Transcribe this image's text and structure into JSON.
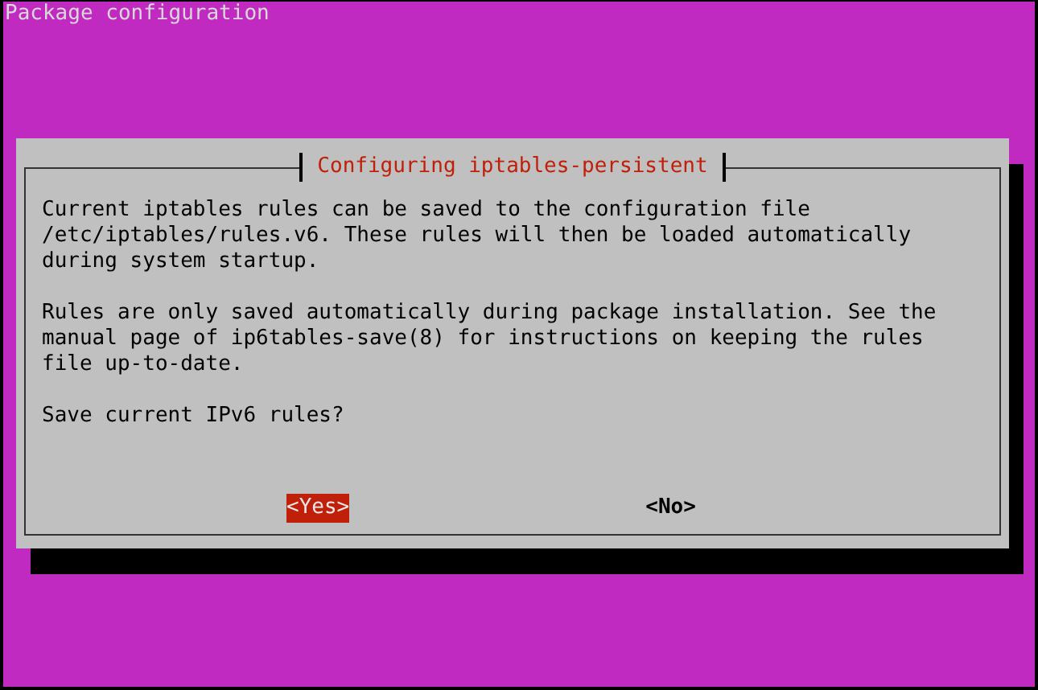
{
  "window": {
    "title": "Package configuration"
  },
  "dialog": {
    "title": "Configuring iptables-persistent",
    "paragraphs": [
      "Current iptables rules can be saved to the configuration file\n/etc/iptables/rules.v6. These rules will then be loaded automatically\nduring system startup.",
      "Rules are only saved automatically during package installation. See the\nmanual page of ip6tables-save(8) for instructions on keeping the rules\nfile up-to-date.",
      "Save current IPv6 rules?"
    ],
    "buttons": [
      {
        "label": "<Yes>",
        "selected": true
      },
      {
        "label": "<No>",
        "selected": false
      }
    ]
  }
}
